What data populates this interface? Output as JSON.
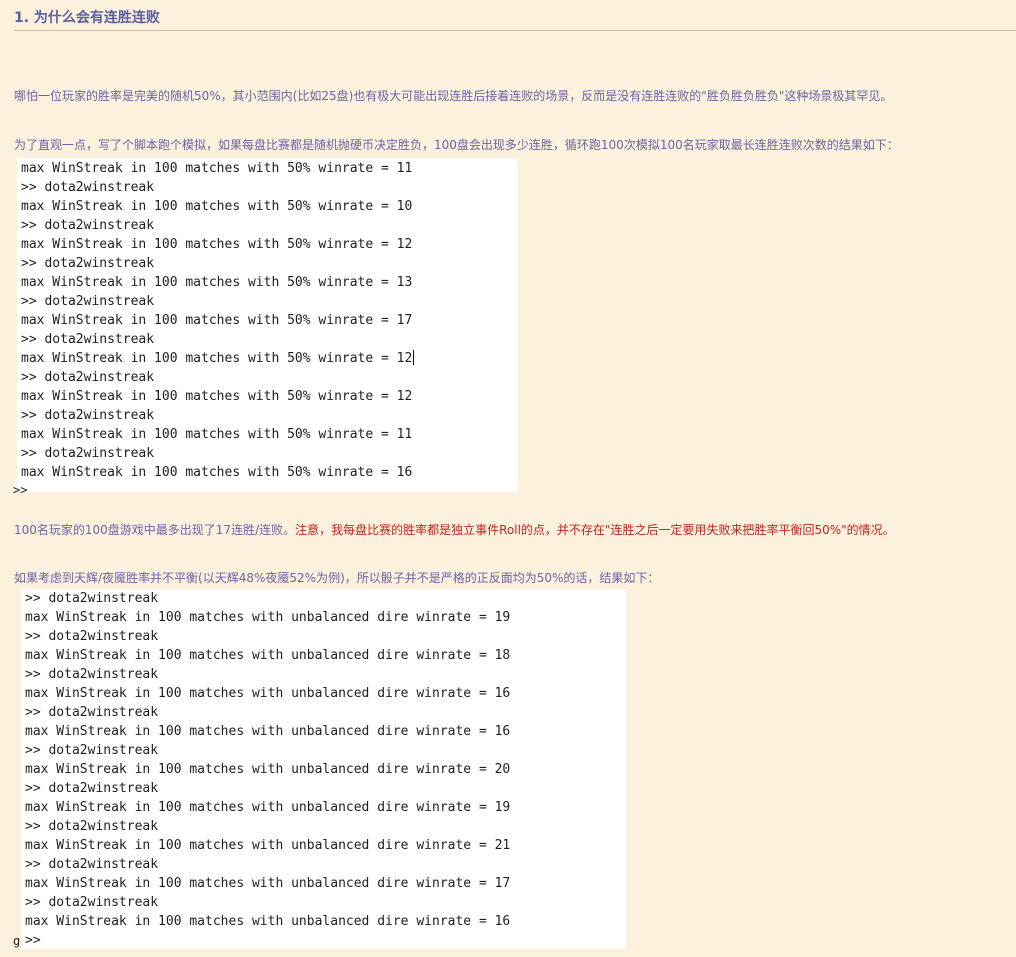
{
  "section_heading": "1. 为什么会有连胜连败",
  "paragraphs": {
    "p1": "哪怕一位玩家的胜率是完美的随机50%，其小范围内(比如25盘)也有极大可能出现连胜后接着连败的场景，反而是没有连胜连败的\"胜负胜负胜负\"这种场景极其罕见。",
    "p2": "为了直观一点，写了个脚本跑个模拟，如果每盘比赛都是随机抛硬币决定胜负，100盘会出现多少连胜，循环跑100次模拟100名玩家取最长连胜连败次数的结果如下：",
    "p3_normal": "100名玩家的100盘游戏中最多出现了17连胜/连败。",
    "p3_note": "注意，我每盘比赛的胜率都是独立事件Roll的点，并不存在\"连胜之后一定要用失败来把胜率平衡回50%\"的情况。",
    "p4": "如果考虑到天辉/夜魇胜率并不平衡(以天辉48%夜魇52%为例)，所以骰子并不是严格的正反面均为50%的话，结果如下："
  },
  "console1": {
    "lines": [
      "max WinStreak in 100 matches with 50% winrate = 11",
      ">> dota2winstreak",
      "max WinStreak in 100 matches with 50% winrate = 10",
      ">> dota2winstreak",
      "max WinStreak in 100 matches with 50% winrate = 12",
      ">> dota2winstreak",
      "max WinStreak in 100 matches with 50% winrate = 13",
      ">> dota2winstreak",
      "max WinStreak in 100 matches with 50% winrate = 17",
      ">> dota2winstreak",
      "max WinStreak in 100 matches with 50% winrate = 12",
      ">> dota2winstreak",
      "max WinStreak in 100 matches with 50% winrate = 12",
      ">> dota2winstreak",
      "max WinStreak in 100 matches with 50% winrate = 11",
      ">> dota2winstreak",
      "max WinStreak in 100 matches with 50% winrate = 16"
    ],
    "cut_prompt": ">> "
  },
  "console2": {
    "lines": [
      ">> dota2winstreak",
      "max WinStreak in 100 matches with unbalanced dire winrate = 19",
      ">> dota2winstreak",
      "max WinStreak in 100 matches with unbalanced dire winrate = 18",
      ">> dota2winstreak",
      "max WinStreak in 100 matches with unbalanced dire winrate = 16",
      ">> dota2winstreak",
      "max WinStreak in 100 matches with unbalanced dire winrate = 16",
      ">> dota2winstreak",
      "max WinStreak in 100 matches with unbalanced dire winrate = 20",
      ">> dota2winstreak",
      "max WinStreak in 100 matches with unbalanced dire winrate = 19",
      ">> dota2winstreak",
      "max WinStreak in 100 matches with unbalanced dire winrate = 21",
      ">> dota2winstreak",
      "max WinStreak in 100 matches with unbalanced dire winrate = 17",
      ">> dota2winstreak",
      "max WinStreak in 100 matches with unbalanced dire winrate = 16",
      ">>"
    ],
    "stray_glyph": "g"
  },
  "colors": {
    "page_background": "#fbf1dc",
    "heading_text": "#5a5fa2",
    "body_text": "#6e63a7",
    "note_text": "#cc1f1f",
    "console_background": "#ffffff",
    "console_text": "#1e1e1e"
  }
}
